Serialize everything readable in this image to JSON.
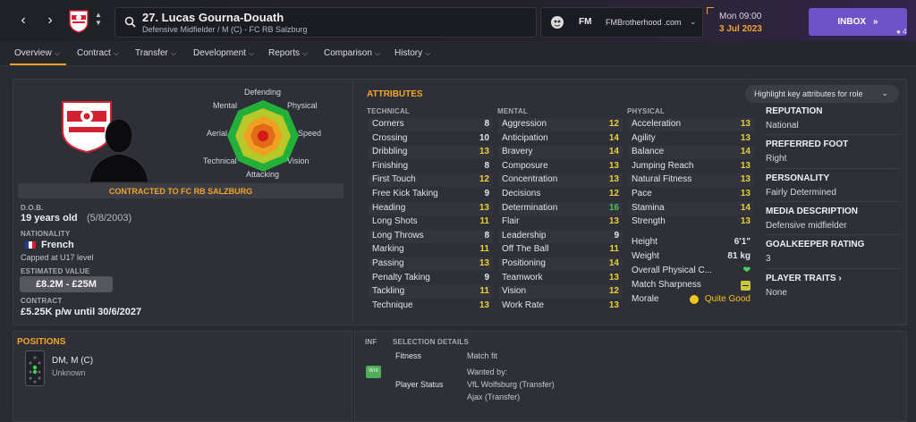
{
  "header": {
    "player_title": "27. Lucas Gourna-Douath",
    "player_subtitle": "Defensive Midfielder / M (C) - FC RB Salzburg",
    "fm_label": "FM",
    "site_label": "FMBrotherhood .com",
    "date_time": "Mon 09:00",
    "date": "3 Jul 2023",
    "inbox_label": "INBOX",
    "inbox_count": "4",
    "colors": {
      "accent": "#f2a42a",
      "inbox": "#6e52c9"
    }
  },
  "tabs": [
    {
      "label": "Overview"
    },
    {
      "label": "Contract"
    },
    {
      "label": "Transfer"
    },
    {
      "label": "Development"
    },
    {
      "label": "Reports"
    },
    {
      "label": "Comparison"
    },
    {
      "label": "History"
    }
  ],
  "profile": {
    "radar_labels": {
      "defending": "Defending",
      "physical": "Physical",
      "speed": "Speed",
      "vision": "Vision",
      "attacking": "Attacking",
      "technical": "Technical",
      "aerial": "Aerial",
      "mental": "Mental"
    },
    "contract_banner": "CONTRACTED TO FC RB SALZBURG",
    "dob_label": "D.O.B.",
    "age": "19 years old",
    "dob": "(5/8/2003)",
    "nationality_label": "NATIONALITY",
    "nationality": "French",
    "caps": "Capped at U17 level",
    "value_label": "ESTIMATED VALUE",
    "value": "£8.2M - £25M",
    "contract_label": "CONTRACT",
    "contract": "£5.25K p/w until 30/6/2027"
  },
  "attributes": {
    "title": "ATTRIBUTES",
    "highlight_dropdown": "Highlight key attributes for role",
    "technical_header": "TECHNICAL",
    "mental_header": "MENTAL",
    "physical_header": "PHYSICAL",
    "technical": [
      {
        "name": "Corners",
        "value": "8"
      },
      {
        "name": "Crossing",
        "value": "10"
      },
      {
        "name": "Dribbling",
        "value": "13"
      },
      {
        "name": "Finishing",
        "value": "8"
      },
      {
        "name": "First Touch",
        "value": "12"
      },
      {
        "name": "Free Kick Taking",
        "value": "9"
      },
      {
        "name": "Heading",
        "value": "13"
      },
      {
        "name": "Long Shots",
        "value": "11"
      },
      {
        "name": "Long Throws",
        "value": "8"
      },
      {
        "name": "Marking",
        "value": "11"
      },
      {
        "name": "Passing",
        "value": "13"
      },
      {
        "name": "Penalty Taking",
        "value": "9"
      },
      {
        "name": "Tackling",
        "value": "11"
      },
      {
        "name": "Technique",
        "value": "13"
      }
    ],
    "mental": [
      {
        "name": "Aggression",
        "value": "12"
      },
      {
        "name": "Anticipation",
        "value": "14"
      },
      {
        "name": "Bravery",
        "value": "14"
      },
      {
        "name": "Composure",
        "value": "13"
      },
      {
        "name": "Concentration",
        "value": "13"
      },
      {
        "name": "Decisions",
        "value": "12"
      },
      {
        "name": "Determination",
        "value": "16"
      },
      {
        "name": "Flair",
        "value": "13"
      },
      {
        "name": "Leadership",
        "value": "9"
      },
      {
        "name": "Off The Ball",
        "value": "11"
      },
      {
        "name": "Positioning",
        "value": "14"
      },
      {
        "name": "Teamwork",
        "value": "13"
      },
      {
        "name": "Vision",
        "value": "12"
      },
      {
        "name": "Work Rate",
        "value": "13"
      }
    ],
    "physical": [
      {
        "name": "Acceleration",
        "value": "13"
      },
      {
        "name": "Agility",
        "value": "13"
      },
      {
        "name": "Balance",
        "value": "14"
      },
      {
        "name": "Jumping Reach",
        "value": "13"
      },
      {
        "name": "Natural Fitness",
        "value": "13"
      },
      {
        "name": "Pace",
        "value": "13"
      },
      {
        "name": "Stamina",
        "value": "14"
      },
      {
        "name": "Strength",
        "value": "13"
      }
    ],
    "height_label": "Height",
    "height": "6'1\"",
    "weight_label": "Weight",
    "weight": "81 kg",
    "overall_physical_label": "Overall Physical C...",
    "match_sharpness_label": "Match Sharpness",
    "morale_label": "Morale",
    "morale": "Quite Good"
  },
  "info": {
    "reputation_label": "REPUTATION",
    "reputation": "National",
    "preferred_foot_label": "PREFERRED FOOT",
    "preferred_foot": "Right",
    "personality_label": "PERSONALITY",
    "personality": "Fairly Determined",
    "media_label": "MEDIA DESCRIPTION",
    "media": "Defensive midfielder",
    "gk_rating_label": "GOALKEEPER RATING",
    "gk_rating": "3",
    "traits_label": "PLAYER TRAITS",
    "traits": "None"
  },
  "positions": {
    "title": "POSITIONS",
    "position": "DM, M (C)",
    "role": "Unknown"
  },
  "selection": {
    "inf_header": "INF",
    "header": "SELECTION DETAILS",
    "fitness_label": "Fitness",
    "fitness": "Match fit",
    "badge": "Wnt",
    "status_label": "Player Status",
    "status_line1": "Wanted by:",
    "status_line2": "VfL Wolfsburg (Transfer)",
    "status_line3": "Ajax (Transfer)"
  }
}
